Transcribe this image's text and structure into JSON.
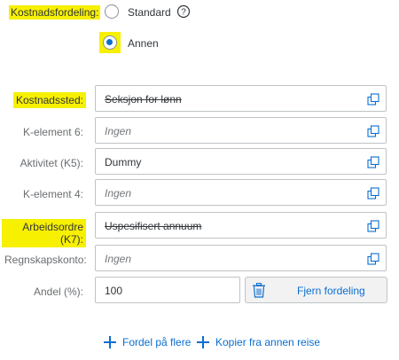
{
  "distribution": {
    "label": "Kostnadsfordeling:",
    "option_standard": "Standard",
    "option_other": "Annen",
    "selected": "Annen"
  },
  "fields": [
    {
      "label": "Kostnadssted:",
      "value": "Seksjon for lønn",
      "placeholder": false,
      "strike": true,
      "highlight": true
    },
    {
      "label": "K-element 6:",
      "value": "Ingen",
      "placeholder": true,
      "strike": false,
      "highlight": false
    },
    {
      "label": "Aktivitet (K5):",
      "value": "Dummy",
      "placeholder": false,
      "strike": false,
      "highlight": false
    },
    {
      "label": "K-element 4:",
      "value": "Ingen",
      "placeholder": true,
      "strike": false,
      "highlight": false
    },
    {
      "label": "Arbeidsordre (K7):",
      "value": "Uspesifisert annuum",
      "placeholder": false,
      "strike": true,
      "highlight": true
    },
    {
      "label": "Regnskapskonto:",
      "value": "Ingen",
      "placeholder": true,
      "strike": false,
      "highlight": false
    }
  ],
  "share": {
    "label": "Andel (%):",
    "value": "100",
    "remove_button": "Fjern fordeling"
  },
  "actions": {
    "distribute_more": "Fordel på flere",
    "copy_from_trip": "Kopier fra annen reise"
  },
  "colors": {
    "highlight": "#f7f000",
    "accent": "#0a6ed1",
    "border": "#bfc3c6"
  }
}
